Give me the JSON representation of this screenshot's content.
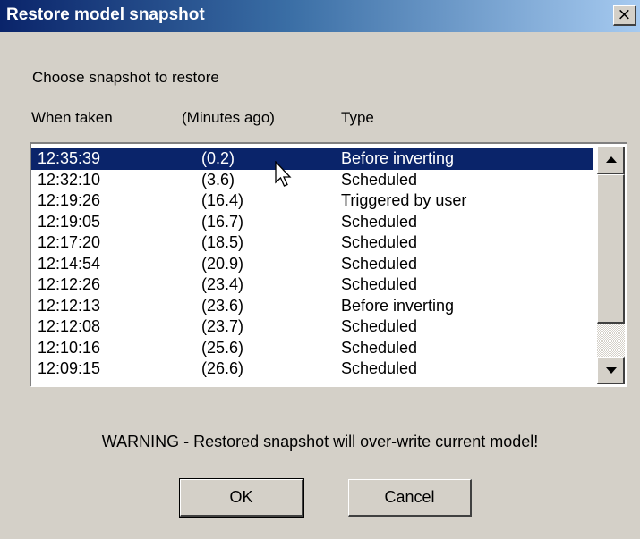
{
  "window": {
    "title": "Restore model snapshot",
    "close_label": "×"
  },
  "prompt": "Choose snapshot to restore",
  "columns": {
    "when": "When taken",
    "minutes": "(Minutes ago)",
    "type": "Type"
  },
  "snapshots": [
    {
      "time": "12:35:39",
      "minutes": "(0.2)",
      "type": "Before inverting",
      "selected": true
    },
    {
      "time": "12:32:10",
      "minutes": "(3.6)",
      "type": "Scheduled"
    },
    {
      "time": "12:19:26",
      "minutes": "(16.4)",
      "type": "Triggered by user"
    },
    {
      "time": "12:19:05",
      "minutes": "(16.7)",
      "type": "Scheduled"
    },
    {
      "time": "12:17:20",
      "minutes": "(18.5)",
      "type": "Scheduled"
    },
    {
      "time": "12:14:54",
      "minutes": "(20.9)",
      "type": "Scheduled"
    },
    {
      "time": "12:12:26",
      "minutes": "(23.4)",
      "type": "Scheduled"
    },
    {
      "time": "12:12:13",
      "minutes": "(23.6)",
      "type": "Before inverting"
    },
    {
      "time": "12:12:08",
      "minutes": "(23.7)",
      "type": "Scheduled"
    },
    {
      "time": "12:10:16",
      "minutes": "(25.6)",
      "type": "Scheduled"
    },
    {
      "time": "12:09:15",
      "minutes": "(26.6)",
      "type": "Scheduled"
    }
  ],
  "warning": "WARNING - Restored snapshot will over-write current model!",
  "buttons": {
    "ok": "OK",
    "cancel": "Cancel"
  },
  "colors": {
    "title_bar_start": "#0a246a",
    "title_bar_end": "#a6caf0",
    "selection": "#0a246a",
    "dialog_bg": "#d4d0c8"
  },
  "icons": {
    "close": "close-icon",
    "scroll_up": "scroll-up-arrow-icon",
    "scroll_down": "scroll-down-arrow-icon",
    "cursor": "mouse-pointer-icon"
  }
}
